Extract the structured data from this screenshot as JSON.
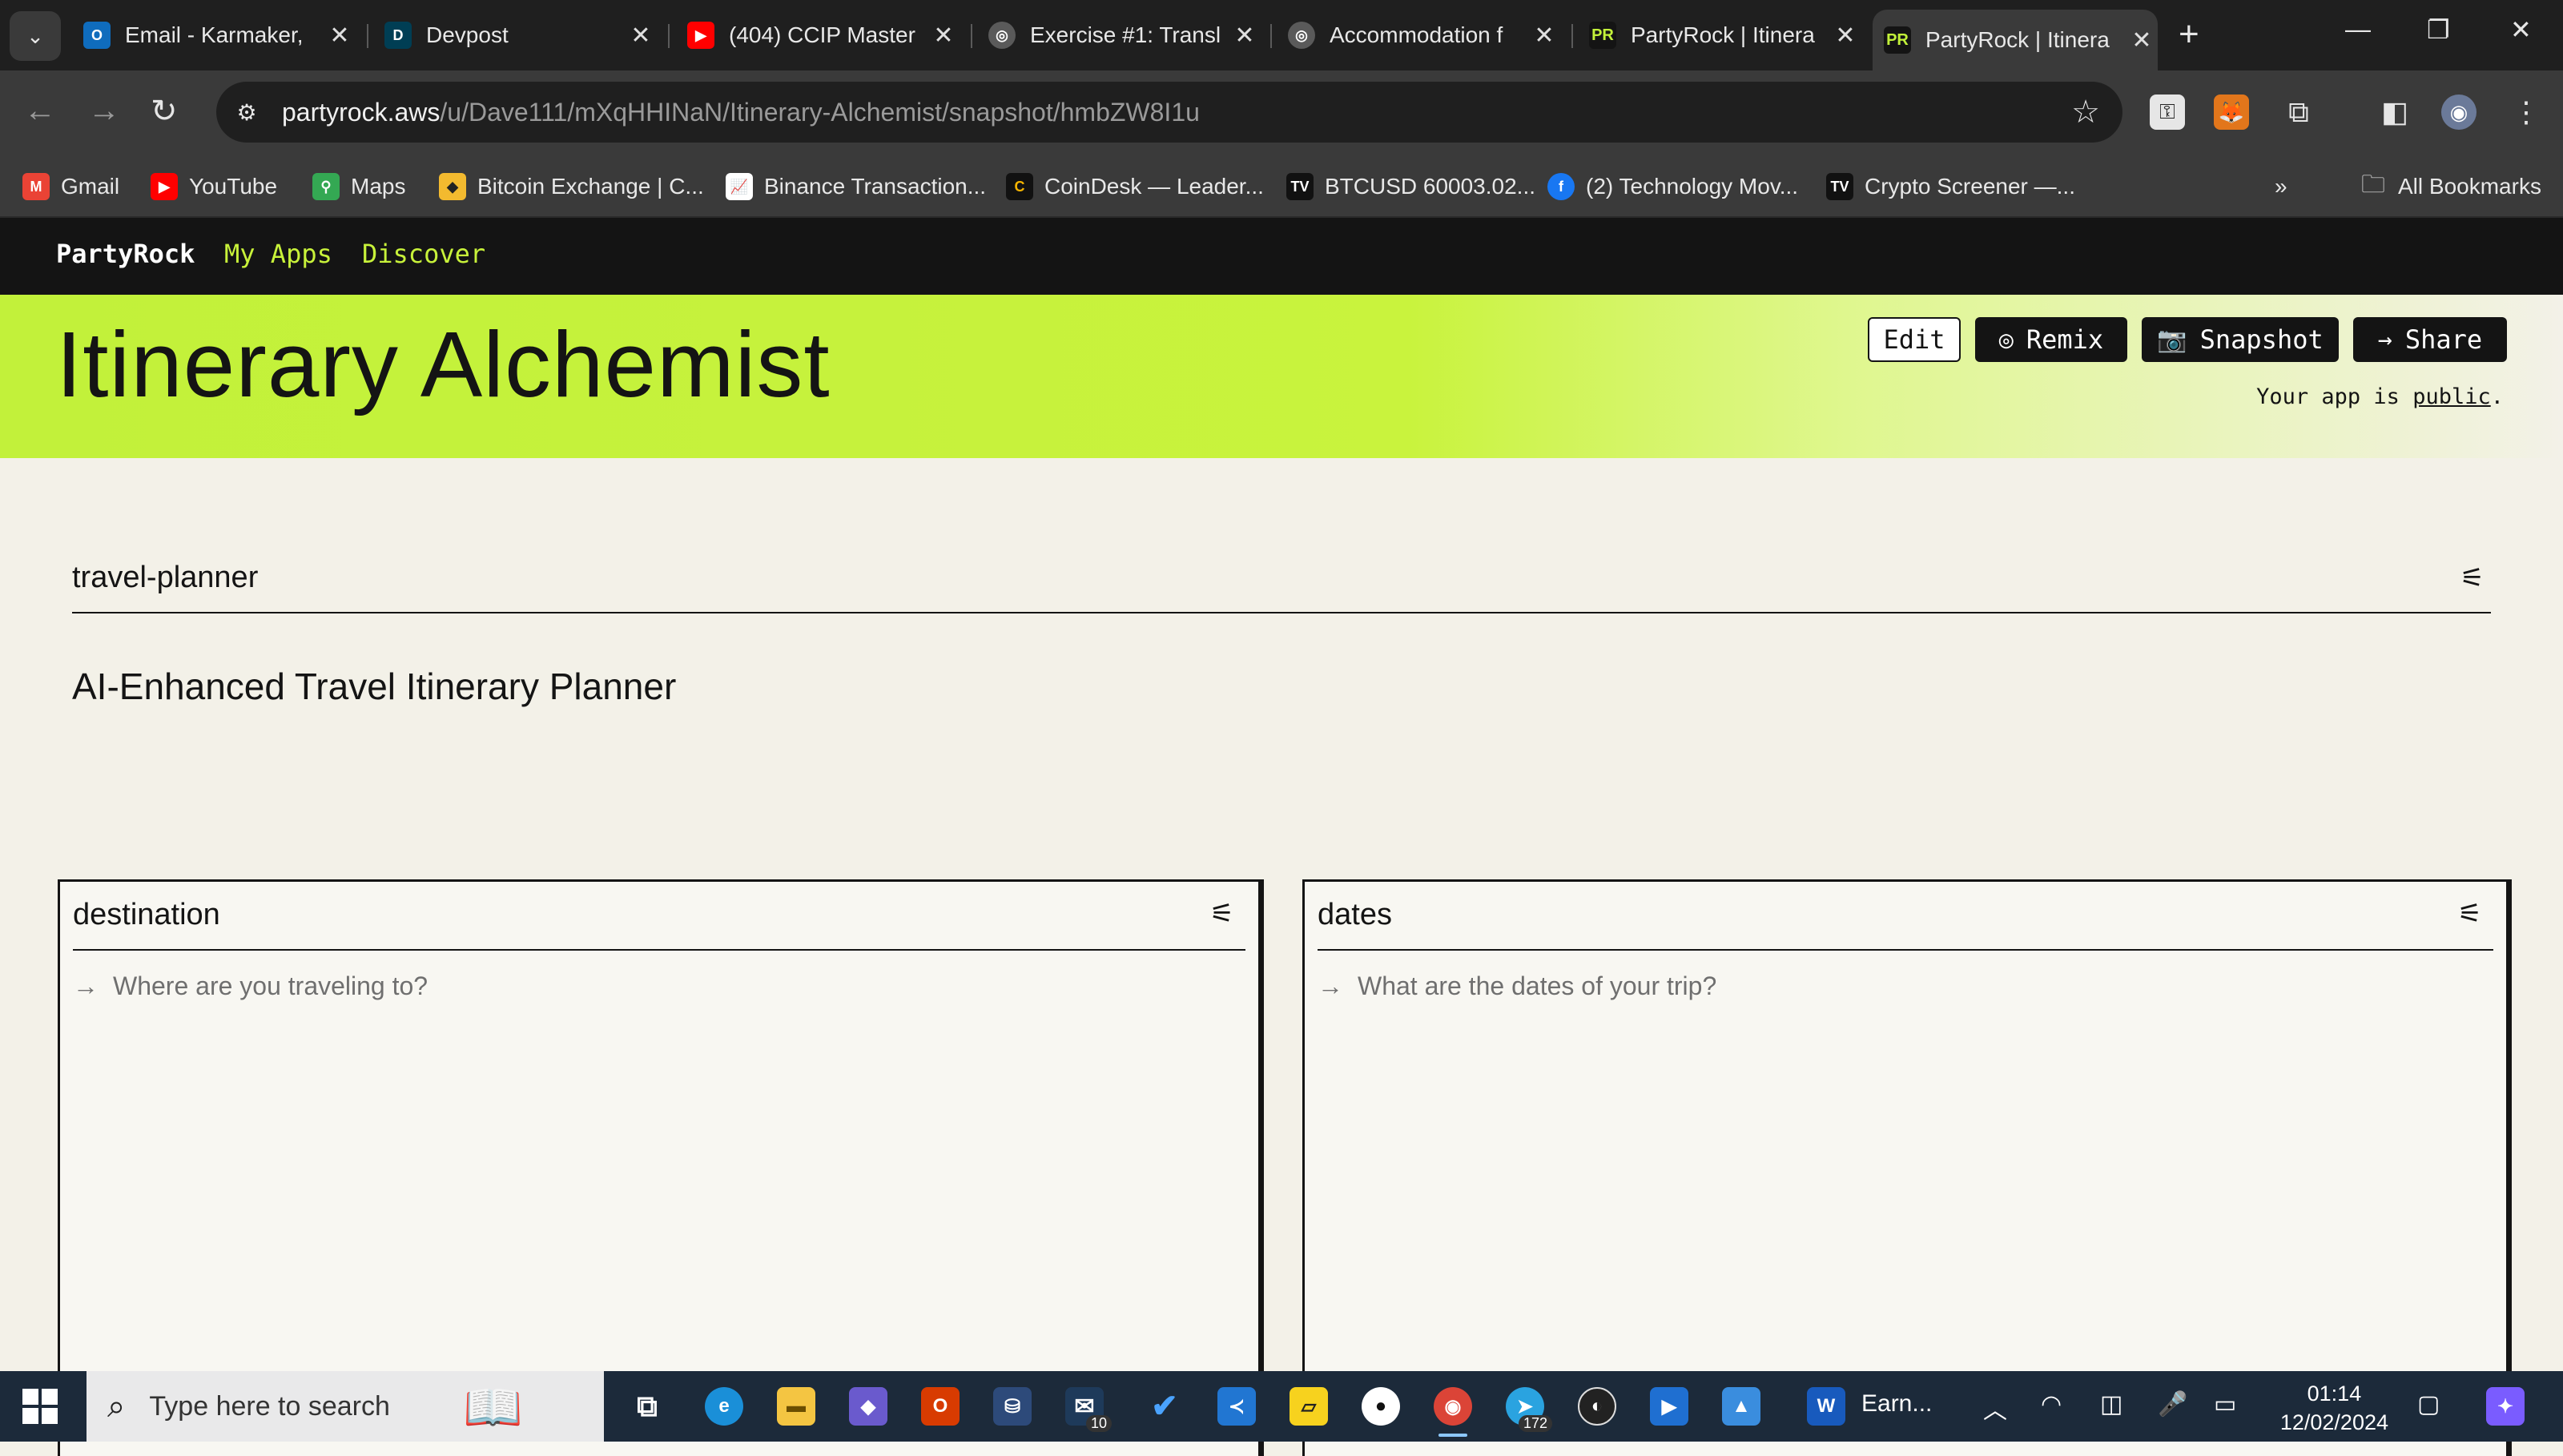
{
  "browser": {
    "tabs": [
      {
        "title": "Email - Karmaker,",
        "icon": "outlook-icon",
        "color": "#0f6cbd"
      },
      {
        "title": "Devpost",
        "icon": "devpost-icon",
        "color": "#003e54"
      },
      {
        "title": "(404) CCIP Master",
        "icon": "youtube-icon",
        "color": "#ff0000"
      },
      {
        "title": "Exercise #1: Transl",
        "icon": "openai-icon",
        "color": "#3a3a3a"
      },
      {
        "title": "Accommodation f",
        "icon": "openai-icon",
        "color": "#3a3a3a"
      },
      {
        "title": "PartyRock | Itinera",
        "icon": "partyrock-icon",
        "color": "#1f1f1f"
      },
      {
        "title": "PartyRock | Itinera",
        "icon": "partyrock-icon",
        "color": "#3a3a3a"
      }
    ],
    "url_host": "partyrock.aws",
    "url_path": "/u/Dave111/mXqHHINaN/Itinerary-Alchemist/snapshot/hmbZW8I1u",
    "bookmarks": [
      {
        "label": "Gmail",
        "icon": "gmail-icon"
      },
      {
        "label": "YouTube",
        "icon": "youtube-icon"
      },
      {
        "label": "Maps",
        "icon": "maps-icon"
      },
      {
        "label": "Bitcoin Exchange | C...",
        "icon": "binance-icon"
      },
      {
        "label": "Binance Transaction...",
        "icon": "chart-icon"
      },
      {
        "label": "CoinDesk — Leader...",
        "icon": "coindesk-icon"
      },
      {
        "label": "BTCUSD 60003.02...",
        "icon": "tradingview-icon"
      },
      {
        "label": "(2) Technology Mov...",
        "icon": "facebook-icon"
      },
      {
        "label": "Crypto Screener —...",
        "icon": "tradingview-icon"
      }
    ],
    "all_bookmarks": "All Bookmarks"
  },
  "app": {
    "brand": "PartyRock",
    "nav": [
      "My Apps",
      "Discover"
    ],
    "title": "Itinerary Alchemist",
    "buttons": {
      "edit": "Edit",
      "remix": "Remix",
      "snapshot": "Snapshot",
      "share": "Share"
    },
    "public_prefix": "Your app is ",
    "public_link": "public",
    "public_suffix": ".",
    "section_name": "travel-planner",
    "description": "AI-Enhanced Travel Itinerary Planner",
    "widgets": [
      {
        "title": "destination",
        "placeholder": "Where are you traveling to?"
      },
      {
        "title": "dates",
        "placeholder": "What are the dates of your trip?"
      }
    ],
    "accent_color": "#c2f13a"
  },
  "taskbar": {
    "search_placeholder": "Type here to search",
    "mail_badge": "10",
    "telegram_badge": "172",
    "word_label": "Earn...",
    "time": "01:14",
    "date": "12/02/2024"
  }
}
